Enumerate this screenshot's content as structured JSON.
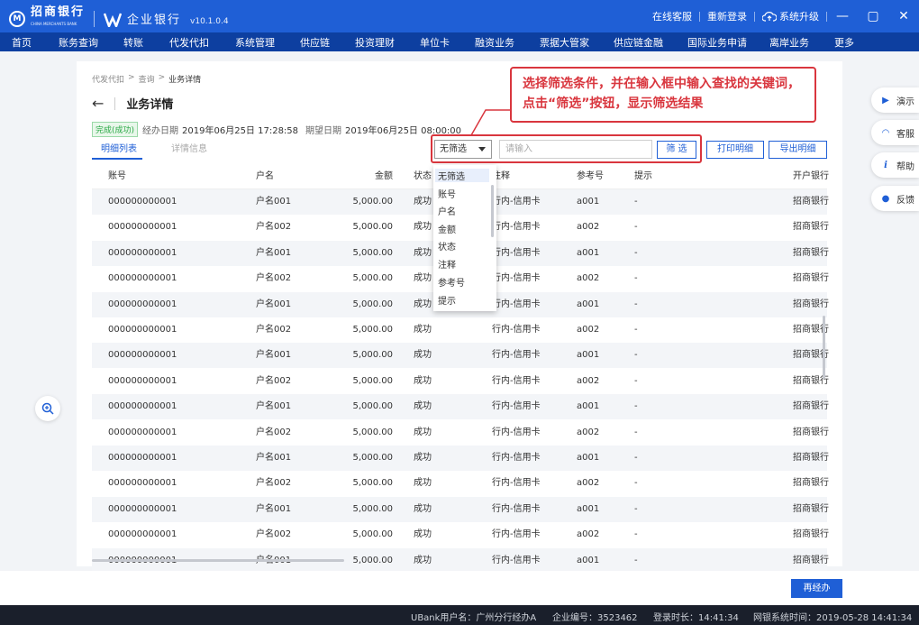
{
  "app": {
    "bank_name": "招商银行",
    "bank_sub": "CHINA MERCHANTS BANK",
    "product": "企业银行",
    "version": "v10.1.0.4",
    "online_service": "在线客服",
    "relogin": "重新登录",
    "upgrade": "系统升级"
  },
  "nav": [
    "首页",
    "账务查询",
    "转账",
    "代发代扣",
    "系统管理",
    "供应链",
    "投资理财",
    "单位卡",
    "融资业务",
    "票据大管家",
    "供应链金融",
    "国际业务申请",
    "离岸业务",
    "更多"
  ],
  "breadcrumb": [
    "代发代扣",
    "查询",
    "业务详情"
  ],
  "page_title": "业务详情",
  "status_badge": "完成(成功)",
  "meta": {
    "handle_label": "经办日期",
    "handle_value": "2019年06月25日 17:28:58",
    "expect_label": "期望日期",
    "expect_value": "2019年06月25日 08:00:00"
  },
  "tabs": [
    "明细列表",
    "详情信息"
  ],
  "filter": {
    "selected": "无筛选",
    "placeholder": "请输入",
    "filter_btn": "筛 选",
    "print_btn": "打印明细",
    "export_btn": "导出明细",
    "options": [
      "无筛选",
      "账号",
      "户名",
      "金额",
      "状态",
      "注释",
      "参考号",
      "提示"
    ]
  },
  "callout": "选择筛选条件，并在输入框中输入查找的关键词，点击“筛选”按钮，显示筛选结果",
  "table": {
    "columns": [
      "账号",
      "户名",
      "金额",
      "状态",
      "注释",
      "参考号",
      "提示",
      "开户银行"
    ],
    "rows": [
      [
        "000000000001",
        "户名001",
        "5,000.00",
        "成功",
        "行内-信用卡",
        "a001",
        "-",
        "招商银行"
      ],
      [
        "000000000001",
        "户名002",
        "5,000.00",
        "成功",
        "行内-信用卡",
        "a002",
        "-",
        "招商银行"
      ],
      [
        "000000000001",
        "户名001",
        "5,000.00",
        "成功",
        "行内-信用卡",
        "a001",
        "-",
        "招商银行"
      ],
      [
        "000000000001",
        "户名002",
        "5,000.00",
        "成功",
        "行内-信用卡",
        "a002",
        "-",
        "招商银行"
      ],
      [
        "000000000001",
        "户名001",
        "5,000.00",
        "成功",
        "行内-信用卡",
        "a001",
        "-",
        "招商银行"
      ],
      [
        "000000000001",
        "户名002",
        "5,000.00",
        "成功",
        "行内-信用卡",
        "a002",
        "-",
        "招商银行"
      ],
      [
        "000000000001",
        "户名001",
        "5,000.00",
        "成功",
        "行内-信用卡",
        "a001",
        "-",
        "招商银行"
      ],
      [
        "000000000001",
        "户名002",
        "5,000.00",
        "成功",
        "行内-信用卡",
        "a002",
        "-",
        "招商银行"
      ],
      [
        "000000000001",
        "户名001",
        "5,000.00",
        "成功",
        "行内-信用卡",
        "a001",
        "-",
        "招商银行"
      ],
      [
        "000000000001",
        "户名002",
        "5,000.00",
        "成功",
        "行内-信用卡",
        "a002",
        "-",
        "招商银行"
      ],
      [
        "000000000001",
        "户名001",
        "5,000.00",
        "成功",
        "行内-信用卡",
        "a001",
        "-",
        "招商银行"
      ],
      [
        "000000000001",
        "户名002",
        "5,000.00",
        "成功",
        "行内-信用卡",
        "a002",
        "-",
        "招商银行"
      ],
      [
        "000000000001",
        "户名001",
        "5,000.00",
        "成功",
        "行内-信用卡",
        "a001",
        "-",
        "招商银行"
      ],
      [
        "000000000001",
        "户名002",
        "5,000.00",
        "成功",
        "行内-信用卡",
        "a002",
        "-",
        "招商银行"
      ],
      [
        "000000000001",
        "户名001",
        "5,000.00",
        "成功",
        "行内-信用卡",
        "a001",
        "-",
        "招商银行"
      ]
    ]
  },
  "side": [
    "演示",
    "客服",
    "帮助",
    "反馈"
  ],
  "reapprove": "再经办",
  "statusbar": {
    "user": "UBank用户名：广州分行经办A",
    "corp": "企业编号：3523462",
    "login": "登录时长：14:41:34",
    "systime": "网银系统时间：2019-05-28  14:41:34"
  },
  "colors": {
    "brand": "#1f5fd6",
    "nav": "#0d3fa0",
    "callout": "#d9363e",
    "success": "#2aa845"
  }
}
